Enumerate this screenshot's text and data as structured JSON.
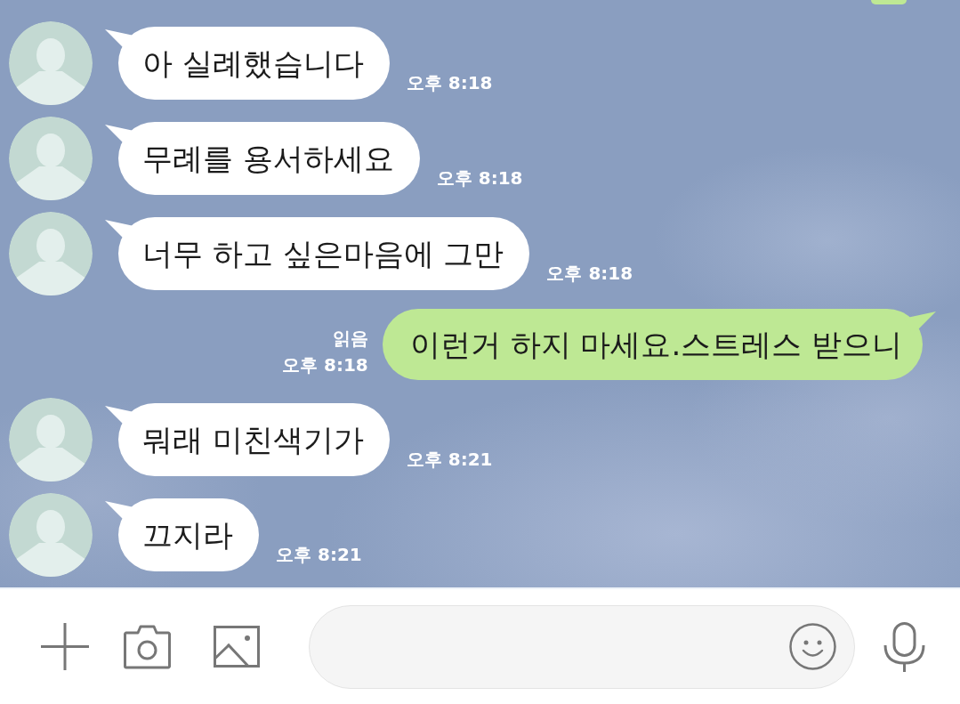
{
  "chat": {
    "messages": [
      {
        "kind": "sent_cut_off"
      },
      {
        "kind": "received",
        "text": "아 실례했습니다",
        "time": "오후 8:18"
      },
      {
        "kind": "received",
        "text": "무례를 용서하세요",
        "time": "오후 8:18"
      },
      {
        "kind": "received",
        "text": "너무 하고 싶은마음에 그만",
        "time": "오후 8:18"
      },
      {
        "kind": "sent",
        "read_label": "읽음",
        "text": "이런거 하지 마세요.스트레스 받으니",
        "time": "오후 8:18"
      },
      {
        "kind": "received",
        "text": "뭐래 미친색기가",
        "time": "오후 8:21"
      },
      {
        "kind": "received",
        "text": "끄지라",
        "time": "오후 8:21"
      }
    ]
  }
}
